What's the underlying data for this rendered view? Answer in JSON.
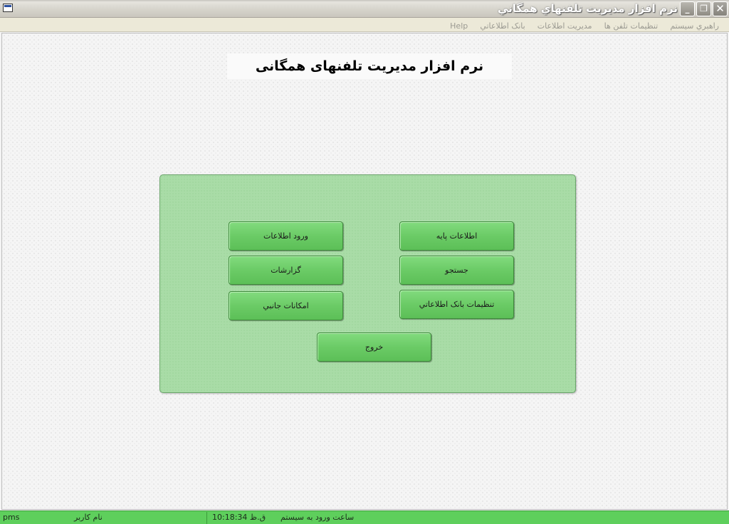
{
  "window": {
    "title": "نرم افزار مدیریت تلفنهاي همگاني",
    "controls": {
      "minimize": "_",
      "restore": "❐",
      "close": "✕"
    }
  },
  "menu": {
    "items": [
      "راهبري سيستم",
      "تنظيمات تلفن ها",
      "مديريت اطلاعات",
      "بانک اطلاعاتي",
      "Help"
    ]
  },
  "main": {
    "heading": "نرم افزار مدیریت تلفنهای همگانی"
  },
  "panel": {
    "buttons": {
      "base_info": "اطلاعات پایه",
      "data_entry": "ورود اطلاعات",
      "search": "جستجو",
      "reports": "گزارشات",
      "db_settings": "تنظيمات بانک اطلاعاتي",
      "side_features": "امکانات جانبي",
      "exit": "خروج"
    }
  },
  "status": {
    "login_label": "ساعت ورود به سيستم",
    "login_time": "ق.ظ 10:18:34",
    "user_label": "نام کاربر",
    "user_value": "pms"
  },
  "colors": {
    "panel_bg": "#a9dca7",
    "button_green": "#6bcb66",
    "status_green": "#5ecf5c",
    "menu_text": "#9b9a92"
  }
}
